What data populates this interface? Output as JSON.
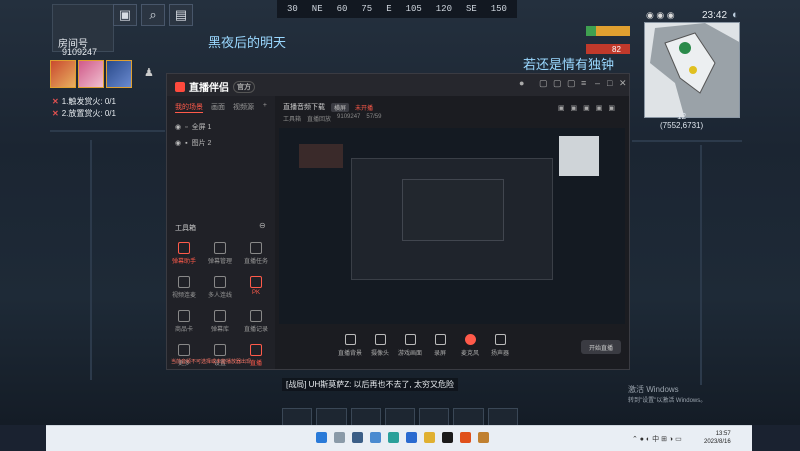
{
  "compass": {
    "ticks": [
      "30",
      "NE",
      "60",
      "75",
      "E",
      "105",
      "120",
      "SE",
      "150"
    ]
  },
  "hud": {
    "room_label": "房间号",
    "room_id": "9109247",
    "tasks": [
      {
        "text": "1.触发赏火: 0/1"
      },
      {
        "text": "2.放置赏火: 0/1"
      }
    ],
    "lyric_1": "黑夜后的明天",
    "lyric_2": "若还是情有独钟",
    "status_value": "82",
    "time": "23:42",
    "minimap_coord": "12\n(7552,6731)"
  },
  "window": {
    "brand": "直播伴侣",
    "version": "官方",
    "sidebar_tabs": [
      "我的场景",
      "画面",
      "视频源"
    ],
    "scenes": [
      "全屏 1",
      "图片 2"
    ],
    "tools_title": "工具箱",
    "tools": [
      {
        "label": "弹幕助手"
      },
      {
        "label": "弹幕管理"
      },
      {
        "label": "直播任务"
      },
      {
        "label": "视频连麦"
      },
      {
        "label": "多人连线"
      },
      {
        "label": "PK"
      },
      {
        "label": "商品卡"
      },
      {
        "label": "弹幕库"
      },
      {
        "label": "直播记录"
      },
      {
        "label": "更多"
      },
      {
        "label": "设置"
      },
      {
        "label": "直播"
      }
    ],
    "main_title": "直播音频下载",
    "main_tag": "横屏",
    "main_live": "未开播",
    "main_sub": [
      "工具箱",
      "直播回放",
      "9109247",
      "57/59"
    ],
    "bottom_items": [
      "直播背景",
      "摄像头",
      "游戏画面",
      "录屏",
      "麦克风",
      "扬声器"
    ],
    "start_label": "开始直播",
    "warn_text": "当前音频不可选择或未能播放器出现"
  },
  "chat": {
    "text": "[战局] UH斯莫萨Z: 以后再也不去了, 太穷又危险"
  },
  "activate": {
    "line1": "激活 Windows",
    "line2": "转到\"设置\"以激活 Windows。"
  },
  "taskbar": {
    "time": "13:57",
    "date": "2023/8/16"
  }
}
